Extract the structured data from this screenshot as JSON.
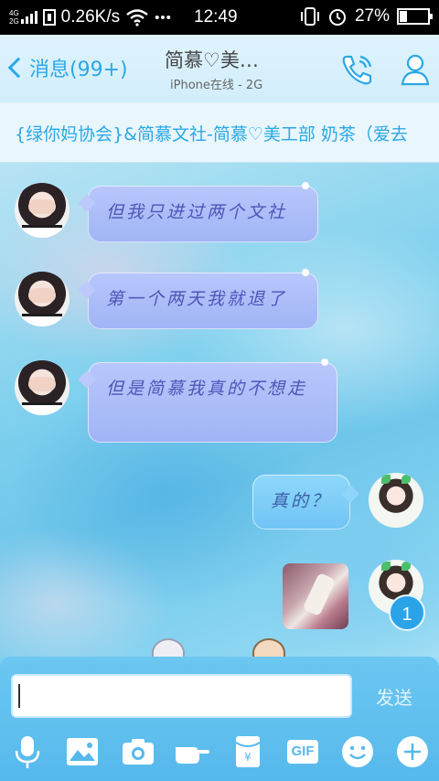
{
  "status_bar": {
    "network_top": "4G",
    "network_bottom": "2G",
    "speed": "0.26K/s",
    "more": "•••",
    "time": "12:49",
    "battery_percent": "27%",
    "battery_level": 0.27
  },
  "header": {
    "back_label": "消息(99+)",
    "title": "简慕♡美…",
    "subtitle": "iPhone在线 - 2G"
  },
  "group_bar": {
    "text": "{绿你妈协会}&简慕文社-简慕♡美工部 奶茶（爱去"
  },
  "messages": [
    {
      "side": "left",
      "text": "但我只进过两个文社"
    },
    {
      "side": "left",
      "text": "第一个两天我就退了"
    },
    {
      "side": "left",
      "text": "但是简慕我真的不想走"
    },
    {
      "side": "right",
      "text": "真的？"
    },
    {
      "side": "right",
      "type": "image"
    }
  ],
  "unread_count": "1",
  "composer": {
    "placeholder": "",
    "send_label": "发送"
  },
  "toolbar": {
    "gif_label": "GIF",
    "icons": [
      "microphone-icon",
      "image-icon",
      "camera-icon",
      "hand-icon",
      "red-packet-icon",
      "gif-icon",
      "emoji-icon",
      "plus-icon"
    ]
  },
  "colors": {
    "accent": "#2aa8e6",
    "bubble_left": "#a9bcf8",
    "bubble_right": "#7fcdf7",
    "bubble_text": "#4d57b8"
  }
}
